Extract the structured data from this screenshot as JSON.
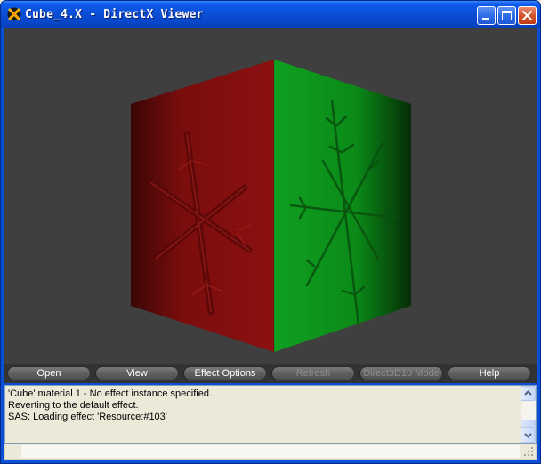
{
  "window": {
    "title": "Cube_4.X - DirectX Viewer"
  },
  "toolbar": {
    "buttons": [
      {
        "label": "Open",
        "enabled": true
      },
      {
        "label": "View",
        "enabled": true
      },
      {
        "label": "Effect Options",
        "enabled": true
      },
      {
        "label": "Refresh",
        "enabled": false
      },
      {
        "label": "Direct3D10 Mode",
        "enabled": false
      },
      {
        "label": "Help",
        "enabled": true
      }
    ]
  },
  "log": {
    "lines": [
      "'Cube' material 1 - No effect instance specified.",
      "Reverting to the default effect.",
      "SAS: Loading effect 'Resource:#103'"
    ]
  },
  "viewport": {
    "cube": {
      "left_face_color": "#8a1010",
      "right_face_color": "#0f9a1f",
      "background_color": "#3f3f3f"
    }
  },
  "icons": {
    "title": "directx-icon",
    "minimize": "minimize-icon",
    "maximize": "maximize-icon",
    "close": "close-icon",
    "scroll_up": "chevron-up-icon",
    "scroll_down": "chevron-down-icon",
    "grip": "resize-grip-icon"
  }
}
